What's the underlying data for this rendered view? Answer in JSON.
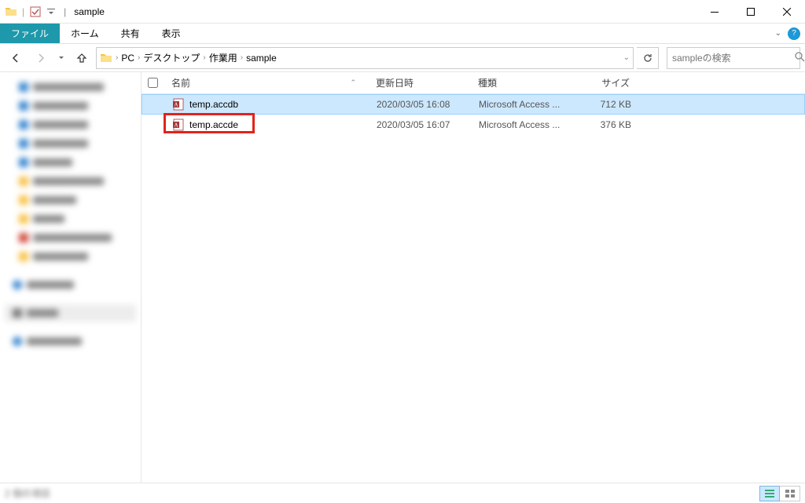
{
  "titlebar": {
    "window_title": "sample"
  },
  "ribbon": {
    "file": "ファイル",
    "home": "ホーム",
    "share": "共有",
    "view": "表示"
  },
  "breadcrumb": {
    "pc": "PC",
    "desktop": "デスクトップ",
    "work": "作業用",
    "sample": "sample"
  },
  "search": {
    "placeholder": "sampleの検索"
  },
  "columns": {
    "name": "名前",
    "date": "更新日時",
    "type": "種類",
    "size": "サイズ"
  },
  "files": [
    {
      "name": "temp.accdb",
      "date": "2020/03/05 16:08",
      "type": "Microsoft Access ...",
      "size": "712 KB",
      "selected": true,
      "highlighted": false
    },
    {
      "name": "temp.accde",
      "date": "2020/03/05 16:07",
      "type": "Microsoft Access ...",
      "size": "376 KB",
      "selected": false,
      "highlighted": true
    }
  ],
  "status": {
    "left": "2 個の項目"
  }
}
